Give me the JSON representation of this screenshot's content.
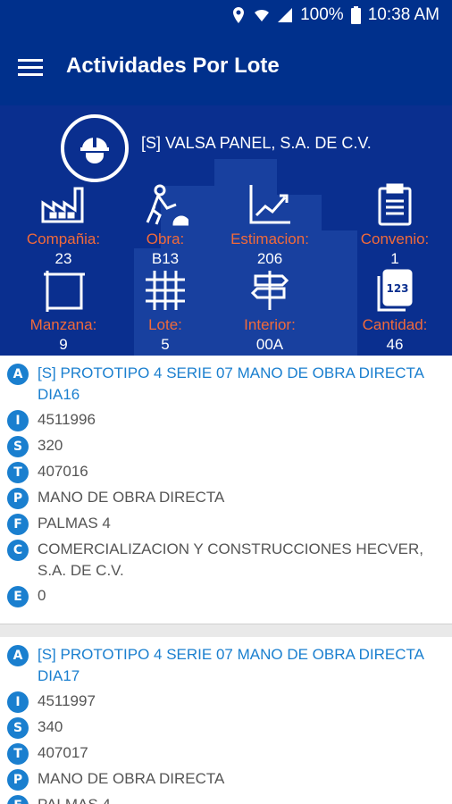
{
  "status": {
    "battery": "100%",
    "time": "10:38 AM"
  },
  "appbar": {
    "title": "Actividades Por Lote"
  },
  "header": {
    "company": "[S] VALSA PANEL, S.A. DE C.V.",
    "stats": [
      {
        "label": "Compañia:",
        "value": "23",
        "icon": "factory-icon"
      },
      {
        "label": "Obra:",
        "value": "B13",
        "icon": "worker-icon"
      },
      {
        "label": "Estimacion:",
        "value": "206",
        "icon": "chart-up-icon"
      },
      {
        "label": "Convenio:",
        "value": "1",
        "icon": "clipboard-icon"
      },
      {
        "label": "Manzana:",
        "value": "9",
        "icon": "frame-icon"
      },
      {
        "label": "Lote:",
        "value": "5",
        "icon": "grid-icon"
      },
      {
        "label": "Interior:",
        "value": "00A",
        "icon": "signpost-icon"
      },
      {
        "label": "Cantidad:",
        "value": "46",
        "icon": "numbers-icon"
      }
    ]
  },
  "cards": [
    {
      "title": "[S] PROTOTIPO 4 SERIE 07 MANO DE OBRA DIRECTA DIA16",
      "rows": [
        {
          "badge": "I",
          "text": "4511996"
        },
        {
          "badge": "S",
          "text": "320"
        },
        {
          "badge": "T",
          "text": "407016"
        },
        {
          "badge": "P",
          "text": "MANO DE OBRA DIRECTA"
        },
        {
          "badge": "F",
          "text": "PALMAS 4"
        },
        {
          "badge": "C",
          "text": "COMERCIALIZACION Y CONSTRUCCIONES HECVER, S.A. DE C.V."
        },
        {
          "badge": "E",
          "text": "0"
        }
      ]
    },
    {
      "title": "[S] PROTOTIPO 4 SERIE 07 MANO DE OBRA DIRECTA DIA17",
      "rows": [
        {
          "badge": "I",
          "text": "4511997"
        },
        {
          "badge": "S",
          "text": "340"
        },
        {
          "badge": "T",
          "text": "407017"
        },
        {
          "badge": "P",
          "text": "MANO DE OBRA DIRECTA"
        },
        {
          "badge": "F",
          "text": "PALMAS 4"
        }
      ]
    }
  ]
}
